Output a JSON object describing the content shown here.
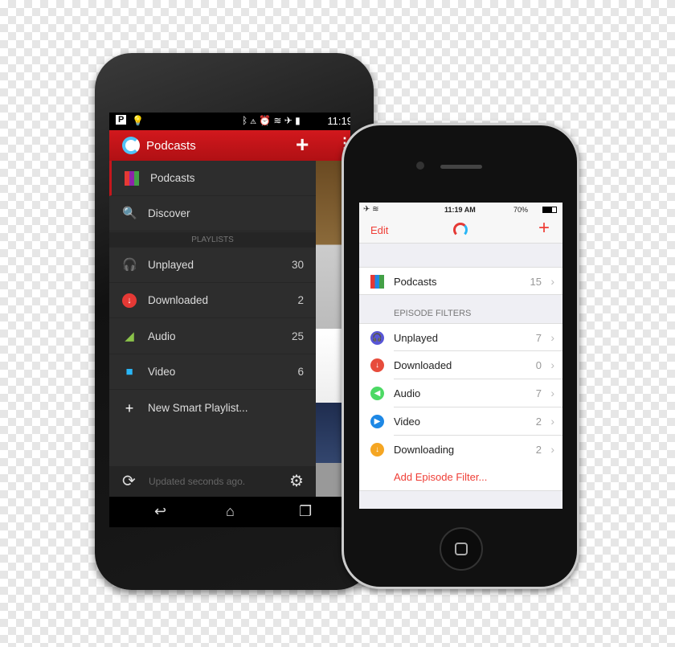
{
  "android": {
    "status": {
      "time": "11:19"
    },
    "app_title": "Podcasts",
    "drawer": {
      "items": [
        {
          "label": "Podcasts",
          "icon": "podcasts-grid-icon"
        },
        {
          "label": "Discover",
          "icon": "discover-magnifier-icon"
        }
      ],
      "section": "PLAYLISTS",
      "playlists": [
        {
          "label": "Unplayed",
          "count": "30",
          "icon": "headphones-icon"
        },
        {
          "label": "Downloaded",
          "count": "2",
          "icon": "download-icon"
        },
        {
          "label": "Audio",
          "count": "25",
          "icon": "audio-icon"
        },
        {
          "label": "Video",
          "count": "6",
          "icon": "video-icon"
        }
      ],
      "new_playlist": "New Smart Playlist...",
      "footer": "Updated seconds ago."
    },
    "accent": "#c4161c"
  },
  "iphone": {
    "status": {
      "time": "11:19 AM",
      "battery": "70%"
    },
    "nav": {
      "edit": "Edit",
      "add": "+"
    },
    "podcasts": {
      "label": "Podcasts",
      "count": "15"
    },
    "section": "EPISODE FILTERS",
    "filters": [
      {
        "label": "Unplayed",
        "count": "7",
        "color": "#5856d6",
        "glyph": "🎧"
      },
      {
        "label": "Downloaded",
        "count": "0",
        "color": "#e74c3c",
        "glyph": "↓"
      },
      {
        "label": "Audio",
        "count": "7",
        "color": "#4cd964",
        "glyph": "◀"
      },
      {
        "label": "Video",
        "count": "2",
        "color": "#1e88e5",
        "glyph": "▶"
      },
      {
        "label": "Downloading",
        "count": "2",
        "color": "#f5a623",
        "glyph": "↓"
      }
    ],
    "add_filter": "Add Episode Filter...",
    "accent": "#ef3e36"
  }
}
